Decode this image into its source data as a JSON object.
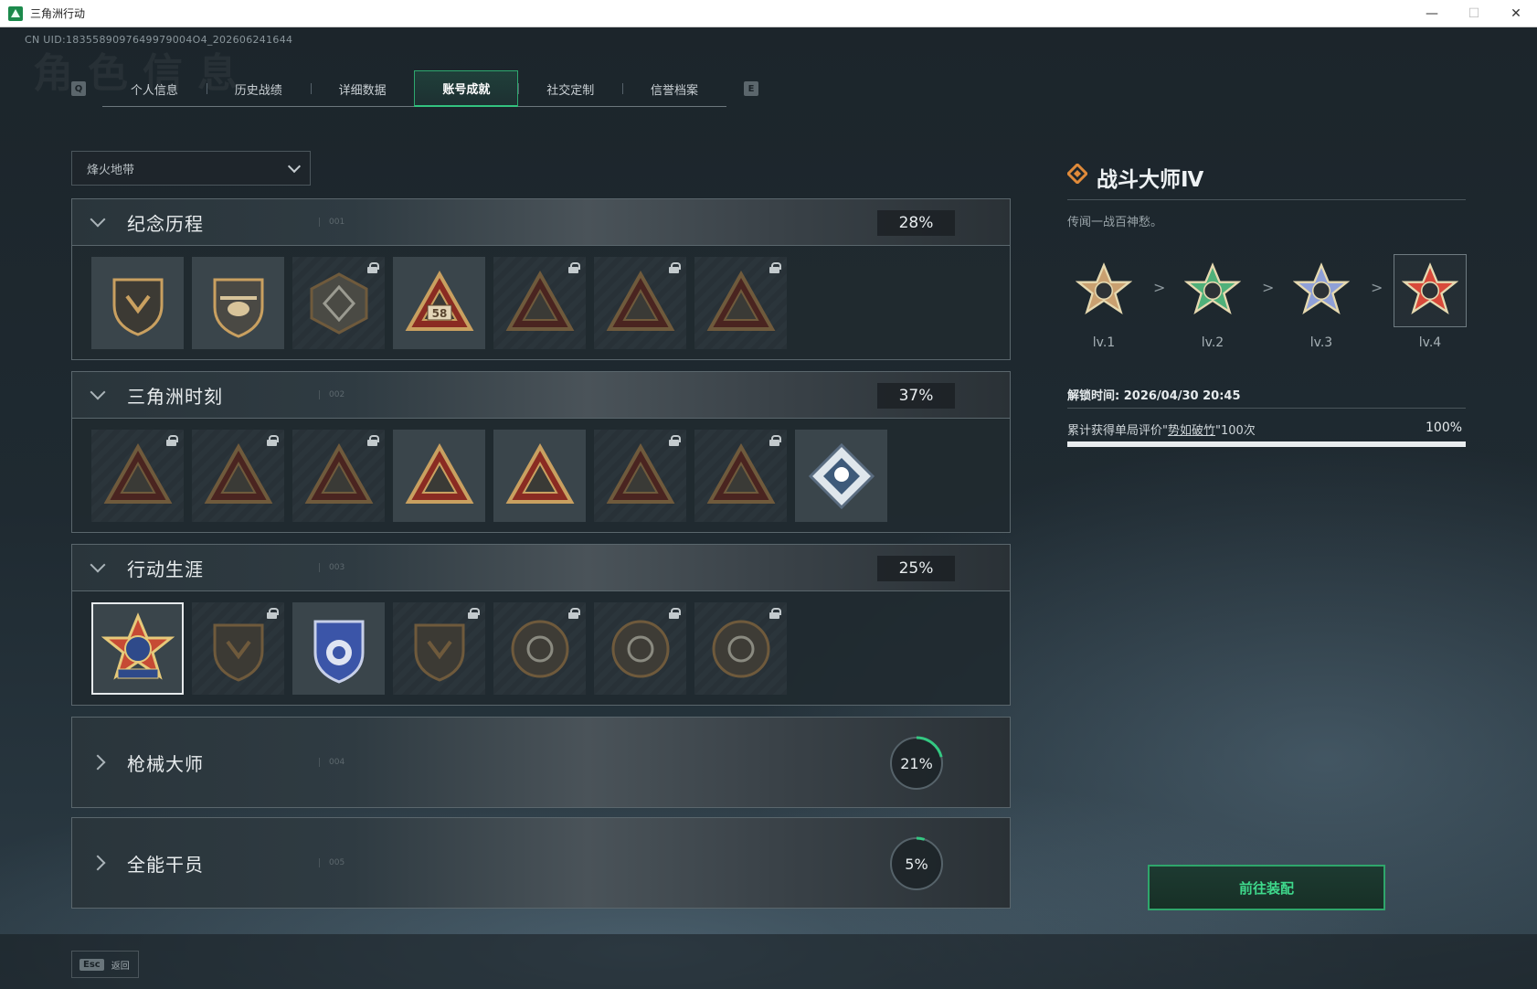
{
  "window": {
    "title": "三角洲行动",
    "controls": {
      "minimize": "—",
      "maximize": "☐",
      "close": "✕"
    }
  },
  "uid": "CN UID:1835589097649979004O4_202606241644",
  "watermark": "角色信息",
  "tabs": {
    "prev_key": "Q",
    "next_key": "E",
    "items": [
      {
        "label": "个人信息",
        "active": false
      },
      {
        "label": "历史战绩",
        "active": false
      },
      {
        "label": "详细数据",
        "active": false
      },
      {
        "label": "账号成就",
        "active": true
      },
      {
        "label": "社交定制",
        "active": false
      },
      {
        "label": "信誉档案",
        "active": false
      }
    ]
  },
  "mode_select": {
    "value": "烽火地带"
  },
  "categories": [
    {
      "title": "纪念历程",
      "code": "001",
      "percent": "28%",
      "expanded": true,
      "badges": [
        {
          "name": "delta-emblem-badge",
          "locked": false
        },
        {
          "name": "helicopter-badge",
          "locked": false
        },
        {
          "name": "shield-emblem-badge",
          "locked": true
        },
        {
          "name": "badge-58",
          "locked": false,
          "text": "58"
        },
        {
          "name": "helicopter-58-badge",
          "locked": true
        },
        {
          "name": "hooded-operator-badge",
          "locked": true
        },
        {
          "name": "crossed-arms-badge",
          "locked": true
        }
      ]
    },
    {
      "title": "三角洲时刻",
      "code": "002",
      "percent": "37%",
      "expanded": true,
      "badges": [
        {
          "name": "figure-badge",
          "locked": true
        },
        {
          "name": "soldier-badge",
          "locked": true
        },
        {
          "name": "kneeling-operator-badge",
          "locked": true
        },
        {
          "name": "hands-dice-badge",
          "locked": false
        },
        {
          "name": "muscle-badge",
          "locked": false
        },
        {
          "name": "beast-badge",
          "locked": true
        },
        {
          "name": "hands-ball-badge",
          "locked": true
        },
        {
          "name": "rose-diamond-badge",
          "locked": false
        }
      ]
    },
    {
      "title": "行动生涯",
      "code": "003",
      "percent": "25%",
      "expanded": true,
      "badges": [
        {
          "name": "combat-master-iv-badge",
          "locked": false,
          "selected": true
        },
        {
          "name": "winged-shield-badge",
          "locked": true
        },
        {
          "name": "police-shield-badge",
          "locked": false
        },
        {
          "name": "hexagram-shield-badge",
          "locked": true
        },
        {
          "name": "orb-circle-badge",
          "locked": true
        },
        {
          "name": "skull-target-badge",
          "locked": true
        },
        {
          "name": "eye-circle-badge",
          "locked": true
        }
      ]
    },
    {
      "title": "枪械大师",
      "code": "004",
      "percent": "21%",
      "percent_value": 0.21,
      "expanded": false
    },
    {
      "title": "全能干员",
      "code": "005",
      "percent": "5%",
      "percent_value": 0.05,
      "expanded": false
    }
  ],
  "detail": {
    "title": "战斗大师Ⅳ",
    "description": "传闻一战百神愁。",
    "levels": [
      {
        "label": "lv.1",
        "color": "#c9a070"
      },
      {
        "label": "lv.2",
        "color": "#4fb07a"
      },
      {
        "label": "lv.3",
        "color": "#8fa0d8"
      },
      {
        "label": "lv.4",
        "color": "#d9493a"
      }
    ],
    "arrow": ">",
    "unlock_time": "解锁时间: 2026/04/30 20:45",
    "requirement_prefix": "累计获得单局评价\"",
    "requirement_highlight": "势如破竹",
    "requirement_suffix": "\"100次",
    "progress_text": "100%",
    "progress": 1.0
  },
  "equip_button": "前往装配",
  "footer": {
    "esc_key": "Esc",
    "esc_label": "返回"
  },
  "colors": {
    "accent": "#2fa66b",
    "gold": "#c9a060",
    "badge_red": "#8a2b22"
  }
}
